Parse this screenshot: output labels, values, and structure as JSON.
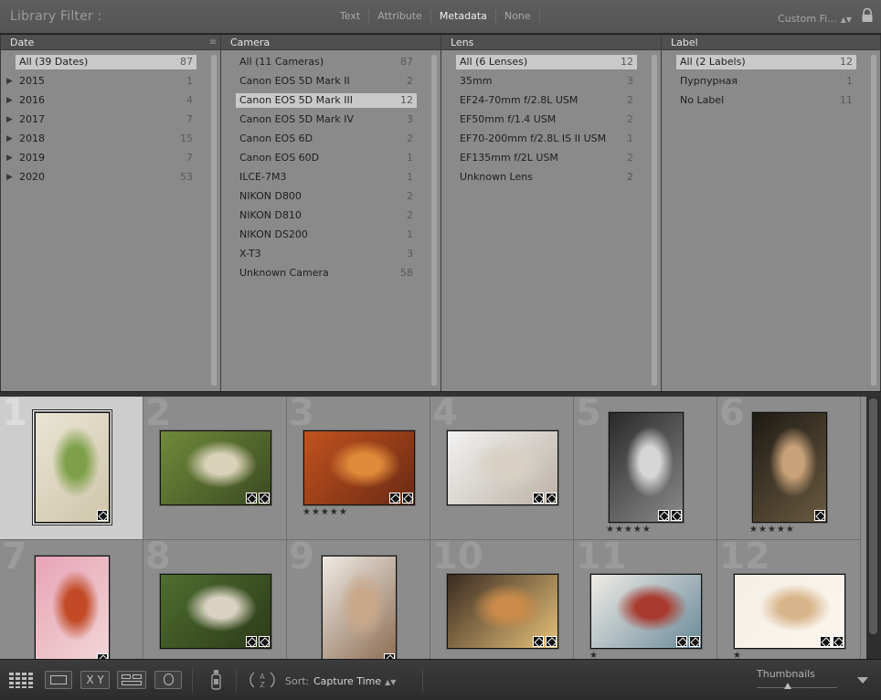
{
  "filter_bar": {
    "title": "Library Filter :",
    "tabs": [
      "Text",
      "Attribute",
      "Metadata",
      "None"
    ],
    "active_tab": "Metadata",
    "preset": "Custom Fi...",
    "lock_icon": "lock-icon"
  },
  "columns": [
    {
      "header": "Date",
      "rows": [
        {
          "label": "All (39 Dates)",
          "count": "87",
          "selected": true
        },
        {
          "label": "2015",
          "count": "1",
          "expander": true
        },
        {
          "label": "2016",
          "count": "4",
          "expander": true
        },
        {
          "label": "2017",
          "count": "7",
          "expander": true
        },
        {
          "label": "2018",
          "count": "15",
          "expander": true
        },
        {
          "label": "2019",
          "count": "7",
          "expander": true
        },
        {
          "label": "2020",
          "count": "53",
          "expander": true
        }
      ]
    },
    {
      "header": "Camera",
      "rows": [
        {
          "label": "All (11 Cameras)",
          "count": "87"
        },
        {
          "label": "Canon EOS 5D Mark II",
          "count": "2"
        },
        {
          "label": "Canon EOS 5D Mark III",
          "count": "12",
          "selected": true
        },
        {
          "label": "Canon EOS 5D Mark IV",
          "count": "3"
        },
        {
          "label": "Canon EOS 6D",
          "count": "2"
        },
        {
          "label": "Canon EOS 60D",
          "count": "1"
        },
        {
          "label": "ILCE-7M3",
          "count": "1"
        },
        {
          "label": "NIKON D800",
          "count": "2"
        },
        {
          "label": "NIKON D810",
          "count": "2"
        },
        {
          "label": "NIKON DS200",
          "count": "1"
        },
        {
          "label": "X-T3",
          "count": "3"
        },
        {
          "label": "Unknown Camera",
          "count": "58"
        }
      ]
    },
    {
      "header": "Lens",
      "rows": [
        {
          "label": "All (6 Lenses)",
          "count": "12",
          "selected": true
        },
        {
          "label": "35mm",
          "count": "3"
        },
        {
          "label": "EF24-70mm f/2.8L USM",
          "count": "2"
        },
        {
          "label": "EF50mm f/1.4 USM",
          "count": "2"
        },
        {
          "label": "EF70-200mm f/2.8L IS II USM",
          "count": "1"
        },
        {
          "label": "EF135mm f/2L USM",
          "count": "2"
        },
        {
          "label": "Unknown Lens",
          "count": "2"
        }
      ]
    },
    {
      "header": "Label",
      "rows": [
        {
          "label": "All (2 Labels)",
          "count": "12",
          "selected": true
        },
        {
          "label": "Пурпурная",
          "count": "1"
        },
        {
          "label": "No Label",
          "count": "11"
        }
      ]
    }
  ],
  "grid": {
    "cells": [
      {
        "index": "1",
        "selected": true,
        "orientation": "portrait",
        "palette": [
          "#e9e4d4",
          "#7fa04a",
          "#cfc6aa"
        ],
        "stars": ""
      },
      {
        "index": "2",
        "orientation": "landscape",
        "palette": [
          "#6f8a3a",
          "#d9d2b8",
          "#3c4a22"
        ],
        "stars": ""
      },
      {
        "index": "3",
        "orientation": "landscape",
        "palette": [
          "#c2521e",
          "#e08b3a",
          "#6a2a14"
        ],
        "stars": "★★★★★"
      },
      {
        "index": "4",
        "orientation": "landscape",
        "palette": [
          "#f2f2f2",
          "#d8d0c4",
          "#bcb2a6"
        ],
        "stars": ""
      },
      {
        "index": "5",
        "orientation": "portrait",
        "palette": [
          "#2a2a2a",
          "#d6d6d6",
          "#8a8a8a"
        ],
        "stars": "★★★★★"
      },
      {
        "index": "6",
        "orientation": "portrait",
        "palette": [
          "#1e1a14",
          "#c9a27a",
          "#6a5a40"
        ],
        "stars": "★★★★★"
      },
      {
        "index": "7",
        "orientation": "portrait",
        "palette": [
          "#e7a3b6",
          "#c24a26",
          "#f2d7d8"
        ],
        "stars": ""
      },
      {
        "index": "8",
        "orientation": "landscape",
        "palette": [
          "#4f6e2e",
          "#d9d2c2",
          "#2c3a1a"
        ],
        "stars": ""
      },
      {
        "index": "9",
        "orientation": "portrait",
        "palette": [
          "#efeae4",
          "#c9a88a",
          "#8a6a50"
        ],
        "stars": ""
      },
      {
        "index": "10",
        "orientation": "landscape",
        "palette": [
          "#3a2a20",
          "#c98a4a",
          "#e6c27a"
        ],
        "stars": ""
      },
      {
        "index": "11",
        "orientation": "landscape",
        "palette": [
          "#f0ece6",
          "#a83a2e",
          "#6a8a9a"
        ],
        "stars": "★"
      },
      {
        "index": "12",
        "orientation": "landscape",
        "palette": [
          "#f4efe6",
          "#d8b48a",
          "#fbf6ee"
        ],
        "stars": "★"
      }
    ]
  },
  "toolbar": {
    "grid_view_icon": "grid-view-icon",
    "loupe_view_icon": "loupe-view-icon",
    "compare_label": "X Y",
    "survey_view_icon": "survey-view-icon",
    "people_view_icon": "people-view-icon",
    "spray_icon": "spray-can-icon",
    "sort_icon": "sort-az-icon",
    "sort_label": "Sort:",
    "sort_value": "Capture Time",
    "thumbnails_label": "Thumbnails",
    "thumbnail_size_fraction": 0.38
  }
}
